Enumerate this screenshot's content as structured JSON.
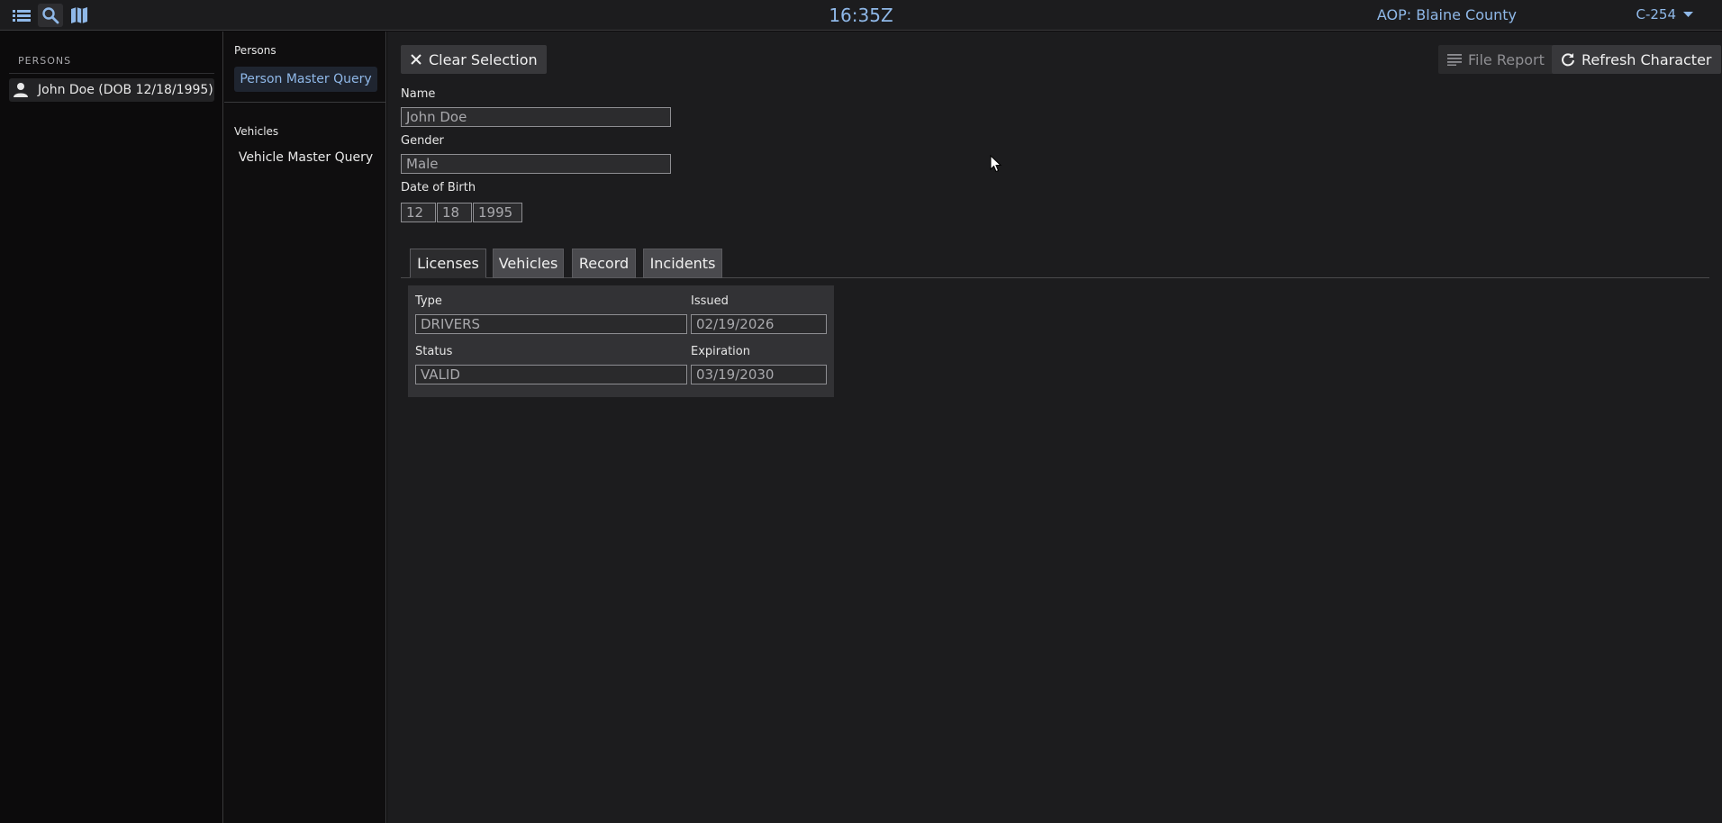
{
  "topbar": {
    "icons": [
      "list-icon",
      "search-icon",
      "map-icon"
    ],
    "clock": "16:35Z",
    "aop": "AOP: Blaine County",
    "unit": "C-254"
  },
  "sidebar": {
    "section_label": "PERSONS",
    "person": "John Doe (DOB 12/18/1995)"
  },
  "menu": {
    "persons_heading": "Persons",
    "person_query": "Person Master Query",
    "vehicles_heading": "Vehicles",
    "vehicle_query": "Vehicle Master Query"
  },
  "main": {
    "clear_selection": "Clear Selection",
    "file_report": "File Report",
    "refresh_character": "Refresh Character",
    "name_label": "Name",
    "name_value": "John Doe",
    "gender_label": "Gender",
    "gender_value": "Male",
    "dob_label": "Date of Birth",
    "dob_month": "12",
    "dob_day": "18",
    "dob_year": "1995",
    "tabs": [
      {
        "label": "Licenses"
      },
      {
        "label": "Vehicles"
      },
      {
        "label": "Record"
      },
      {
        "label": "Incidents"
      }
    ],
    "license": {
      "type_label": "Type",
      "type_value": "DRIVERS",
      "issued_label": "Issued",
      "issued_value": "02/19/2026",
      "status_label": "Status",
      "status_value": "VALID",
      "expiration_label": "Expiration",
      "expiration_value": "03/19/2030"
    }
  },
  "colors": {
    "accent": "#8fb8e8",
    "panel": "#1c1c1e",
    "background": "#0c0b0c"
  }
}
